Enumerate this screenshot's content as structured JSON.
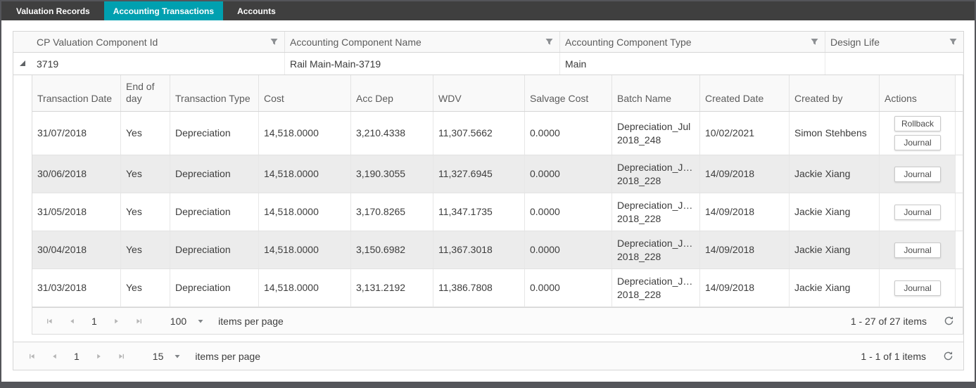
{
  "colors": {
    "active_tab": "#00a0b0",
    "tab_bar": "#3f3f3f",
    "frame_border": "#54555a",
    "alt_row": "#ececec"
  },
  "tabs": [
    {
      "label": "Valuation Records",
      "active": false
    },
    {
      "label": "Accounting Transactions",
      "active": true
    },
    {
      "label": "Accounts",
      "active": false
    }
  ],
  "master_grid": {
    "columns": [
      "CP Valuation Component Id",
      "Accounting Component Name",
      "Accounting Component Type",
      "Design Life"
    ],
    "row": {
      "cp_valuation_component_id": "3719",
      "accounting_component_name": "Rail Main-Main-3719",
      "accounting_component_type": "Main",
      "design_life": ""
    }
  },
  "detail_grid": {
    "columns": [
      "Transaction Date",
      "End of day",
      "Transaction Type",
      "Cost",
      "Acc Dep",
      "WDV",
      "Salvage Cost",
      "Batch Name",
      "Created Date",
      "Created by",
      "Actions"
    ],
    "rows": [
      {
        "transaction_date": "31/07/2018",
        "end_of_day": "Yes",
        "transaction_type": "Depreciation",
        "cost": "14,518.0000",
        "acc_dep": "3,210.4338",
        "wdv": "11,307.5662",
        "salvage_cost": "0.0000",
        "batch_name": "Depreciation_Jul 2018_248",
        "created_date": "10/02/2021",
        "created_by": "Simon Stehbens",
        "actions": [
          "Rollback",
          "Journal"
        ]
      },
      {
        "transaction_date": "30/06/2018",
        "end_of_day": "Yes",
        "transaction_type": "Depreciation",
        "cost": "14,518.0000",
        "acc_dep": "3,190.3055",
        "wdv": "11,327.6945",
        "salvage_cost": "0.0000",
        "batch_name": "Depreciation_J… 2018_228",
        "created_date": "14/09/2018",
        "created_by": "Jackie Xiang",
        "actions": [
          "Journal"
        ]
      },
      {
        "transaction_date": "31/05/2018",
        "end_of_day": "Yes",
        "transaction_type": "Depreciation",
        "cost": "14,518.0000",
        "acc_dep": "3,170.8265",
        "wdv": "11,347.1735",
        "salvage_cost": "0.0000",
        "batch_name": "Depreciation_J… 2018_228",
        "created_date": "14/09/2018",
        "created_by": "Jackie Xiang",
        "actions": [
          "Journal"
        ]
      },
      {
        "transaction_date": "30/04/2018",
        "end_of_day": "Yes",
        "transaction_type": "Depreciation",
        "cost": "14,518.0000",
        "acc_dep": "3,150.6982",
        "wdv": "11,367.3018",
        "salvage_cost": "0.0000",
        "batch_name": "Depreciation_J… 2018_228",
        "created_date": "14/09/2018",
        "created_by": "Jackie Xiang",
        "actions": [
          "Journal"
        ]
      },
      {
        "transaction_date": "31/03/2018",
        "end_of_day": "Yes",
        "transaction_type": "Depreciation",
        "cost": "14,518.0000",
        "acc_dep": "3,131.2192",
        "wdv": "11,386.7808",
        "salvage_cost": "0.0000",
        "batch_name": "Depreciation_J… 2018_228",
        "created_date": "14/09/2018",
        "created_by": "Jackie Xiang",
        "actions": [
          "Journal"
        ]
      }
    ],
    "pager": {
      "page": "1",
      "page_size": "100",
      "items_per_page_label": "items per page",
      "range_label": "1 - 27 of 27 items"
    }
  },
  "outer_pager": {
    "page": "1",
    "page_size": "15",
    "items_per_page_label": "items per page",
    "range_label": "1 - 1 of 1 items"
  }
}
